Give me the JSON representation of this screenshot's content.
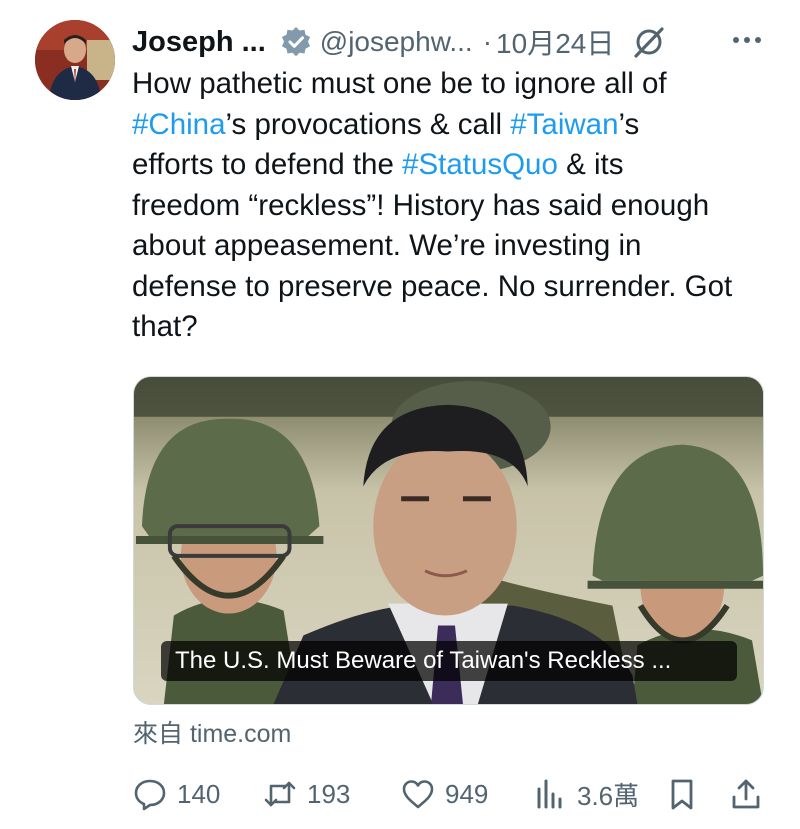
{
  "author": {
    "name": "Joseph ...",
    "handle": "@josephw...",
    "separator": "·",
    "date": "10月24日"
  },
  "tweet": {
    "segments": [
      {
        "text": "How pathetic must one be to ignore all of\n",
        "hashtag": false
      },
      {
        "text": "#China",
        "hashtag": true
      },
      {
        "text": "’s provocations & call ",
        "hashtag": false
      },
      {
        "text": "#Taiwan",
        "hashtag": true
      },
      {
        "text": "’s\nefforts to defend the ",
        "hashtag": false
      },
      {
        "text": "#StatusQuo",
        "hashtag": true
      },
      {
        "text": " & its\nfreedom “reckless”! History has said enough\nabout appeasement. We’re investing in\ndefense to preserve peace. No surrender. Got\nthat?",
        "hashtag": false
      }
    ]
  },
  "card": {
    "title": "The U.S. Must Beware of Taiwan's Reckless ...",
    "source": "來自 time.com"
  },
  "actions": {
    "replies": "140",
    "reposts": "193",
    "likes": "949",
    "views": "3.6萬"
  },
  "colors": {
    "hashtag": "#1d9bf0",
    "secondary_text": "#536471",
    "verified_badge": "#829aab"
  },
  "icons": [
    "verified-badge-icon",
    "grok-icon",
    "more-icon",
    "reply-icon",
    "repost-icon",
    "like-icon",
    "views-icon",
    "bookmark-icon",
    "share-icon"
  ]
}
